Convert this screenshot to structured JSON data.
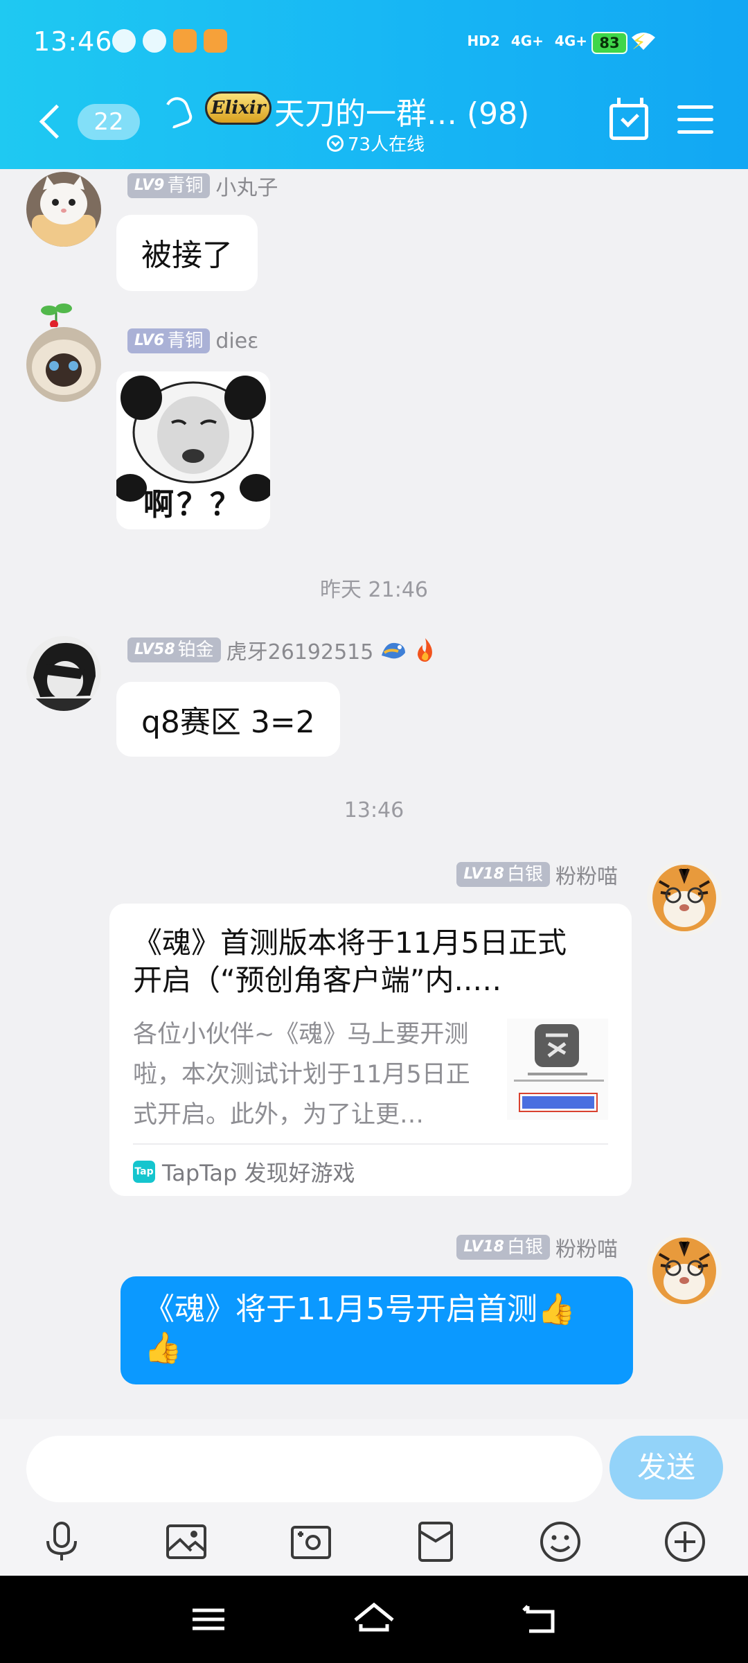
{
  "status_bar": {
    "time": "13:46",
    "network_labels": [
      "HD2",
      "4G+",
      "4G+"
    ],
    "battery": "83"
  },
  "header": {
    "unread_count": "22",
    "group_badge": "Elixir",
    "title": "天刀的一群… (98)",
    "online": "73人在线"
  },
  "messages": [
    {
      "level": "LV9",
      "rank": "青铜",
      "sender": "小丸子",
      "text": "被接了"
    },
    {
      "level": "LV6",
      "rank": "青铜",
      "sender": "dieɛ",
      "sticker_caption": "啊？？"
    },
    {
      "level": "LV58",
      "rank": "铂金",
      "sender": "虎牙26192515",
      "text": "q8赛区 3=2"
    },
    {
      "level": "LV18",
      "rank": "白银",
      "sender": "粉粉喵"
    },
    {
      "level": "LV18",
      "rank": "白银",
      "sender": "粉粉喵",
      "text_line1": "《魂》将于11月5号开启首测👍",
      "text_line2": "👍"
    }
  ],
  "timestamps": [
    "昨天 21:46",
    "13:46"
  ],
  "share_card": {
    "title_line1": "《魂》首测版本将于11月5日正式",
    "title_line2": "开启（“预创角客户端”内..…",
    "desc_line1": "各位小伙伴~《魂》马上要开测",
    "desc_line2": "啦，本次测试计划于11月5日正",
    "desc_line3": "式开启。此外，为了让更…",
    "source_icon": "Tap",
    "source": "TapTap 发现好游戏"
  },
  "input": {
    "placeholder": "",
    "send_label": "发送"
  },
  "colors": {
    "header_start": "#1fc9f2",
    "header_end": "#12a7f3",
    "self_bubble": "#0b99ff",
    "send_button": "#93d3f9"
  }
}
